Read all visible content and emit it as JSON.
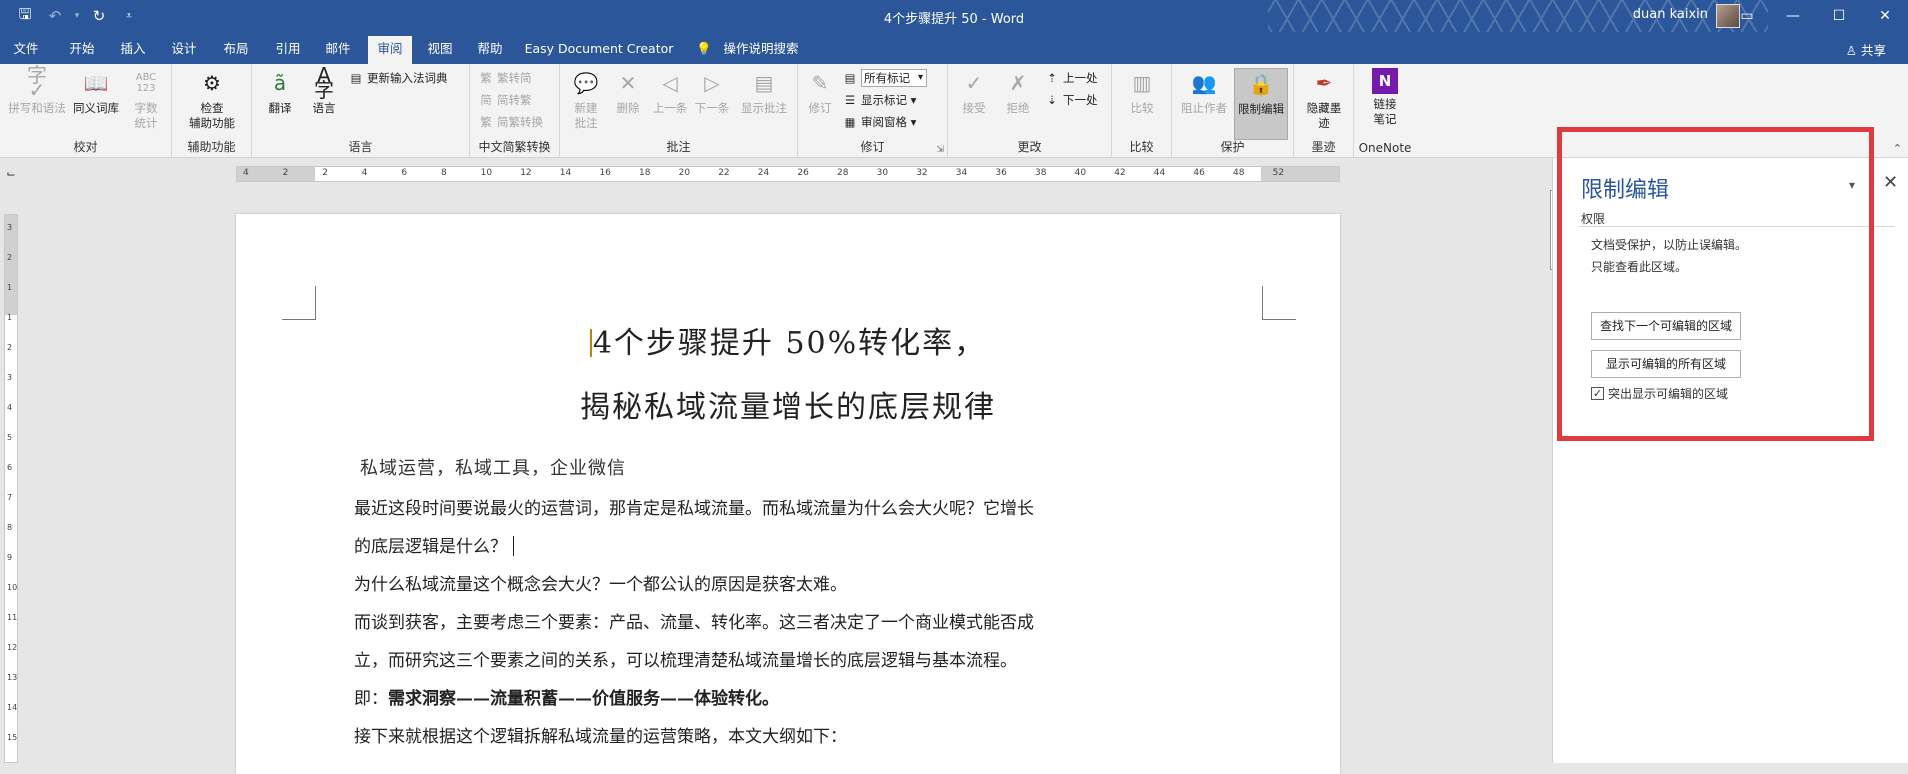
{
  "title_bar": {
    "title": "4个步骤提升 50 - Word",
    "user": "duan kaixin"
  },
  "tabs": [
    "文件",
    "开始",
    "插入",
    "设计",
    "布局",
    "引用",
    "邮件",
    "审阅",
    "视图",
    "帮助",
    "Easy Document Creator",
    "操作说明搜索"
  ],
  "active_tab": "审阅",
  "share": "共享",
  "ribbon": {
    "proof": {
      "label": "校对",
      "spell": "拼写和语法",
      "thesaurus": "同义词库",
      "wordcount": "字数\n统计",
      "wordcount_icon": "ABC\n123"
    },
    "access": {
      "label": "辅助功能",
      "check": "检查\n辅助功能"
    },
    "lang": {
      "label": "语言",
      "translate": "翻译",
      "language": "语言",
      "ime": "更新输入法词典"
    },
    "chinese": {
      "label": "中文简繁转换",
      "t2s": "繁转简",
      "s2t": "简转繁",
      "convert": "简繁转换"
    },
    "comments": {
      "label": "批注",
      "new": "新建\n批注",
      "delete": "删除",
      "prev": "上一条",
      "next": "下一条",
      "show": "显示批注"
    },
    "tracking": {
      "label": "修订",
      "track": "修订",
      "markup_value": "所有标记",
      "show_markup": "显示标记",
      "review_pane": "审阅窗格"
    },
    "changes": {
      "label": "更改",
      "accept": "接受",
      "reject": "拒绝",
      "prev": "上一处",
      "next": "下一处"
    },
    "compare": {
      "label": "比较",
      "compare": "比较"
    },
    "protect": {
      "label": "保护",
      "block": "阻止作者",
      "restrict": "限制编辑"
    },
    "ink": {
      "label": "墨迹",
      "hide": "隐藏墨\n迹"
    },
    "onenote": {
      "label": "OneNote",
      "link": "链接\n笔记"
    }
  },
  "ruler_numbers": [
    "4",
    "2",
    "2",
    "4",
    "6",
    "8",
    "10",
    "12",
    "14",
    "16",
    "18",
    "20",
    "22",
    "24",
    "26",
    "28",
    "30",
    "32",
    "34",
    "36",
    "38",
    "40",
    "42",
    "44",
    "46",
    "48",
    "52"
  ],
  "vruler_numbers": [
    "3",
    "2",
    "1",
    "1",
    "2",
    "3",
    "4",
    "5",
    "6",
    "7",
    "8",
    "9",
    "10",
    "11",
    "12",
    "13",
    "14",
    "15"
  ],
  "document": {
    "title1": "4个步骤提升 50%转化率，",
    "title2": "揭秘私域流量增长的底层规律",
    "tags": "私域运营，私域工具，企业微信",
    "p1a": "最近这段时间要说最火的运营词，那肯定是私域流量。而私域流量为什么会大火呢？它增长",
    "p1b": "的底层逻辑是什么？",
    "p2": "为什么私域流量这个概念会大火？一个都公认的原因是获客太难。",
    "p3a": "而谈到获客，主要考虑三个要素：产品、流量、转化率。这三者决定了一个商业模式能否成",
    "p3b": "立，而研究这三个要素之间的关系，可以梳理清楚私域流量增长的底层逻辑与基本流程。",
    "p4_prefix": "即：",
    "p4_bold": "需求洞察——流量积蓄——价值服务——体验转化。",
    "p5": "接下来就根据这个逻辑拆解私域流量的运营策略，本文大纲如下："
  },
  "pane": {
    "title": "限制编辑",
    "subtitle": "权限",
    "msg1": "文档受保护，以防止误编辑。",
    "msg2": "只能查看此区域。",
    "btn_find": "查找下一个可编辑的区域",
    "btn_show": "显示可编辑的所有区域",
    "highlight": "突出显示可编辑的区域",
    "highlight_checked": true
  },
  "colors": {
    "brand": "#2b579a",
    "highlight_box": "#e0393e"
  }
}
